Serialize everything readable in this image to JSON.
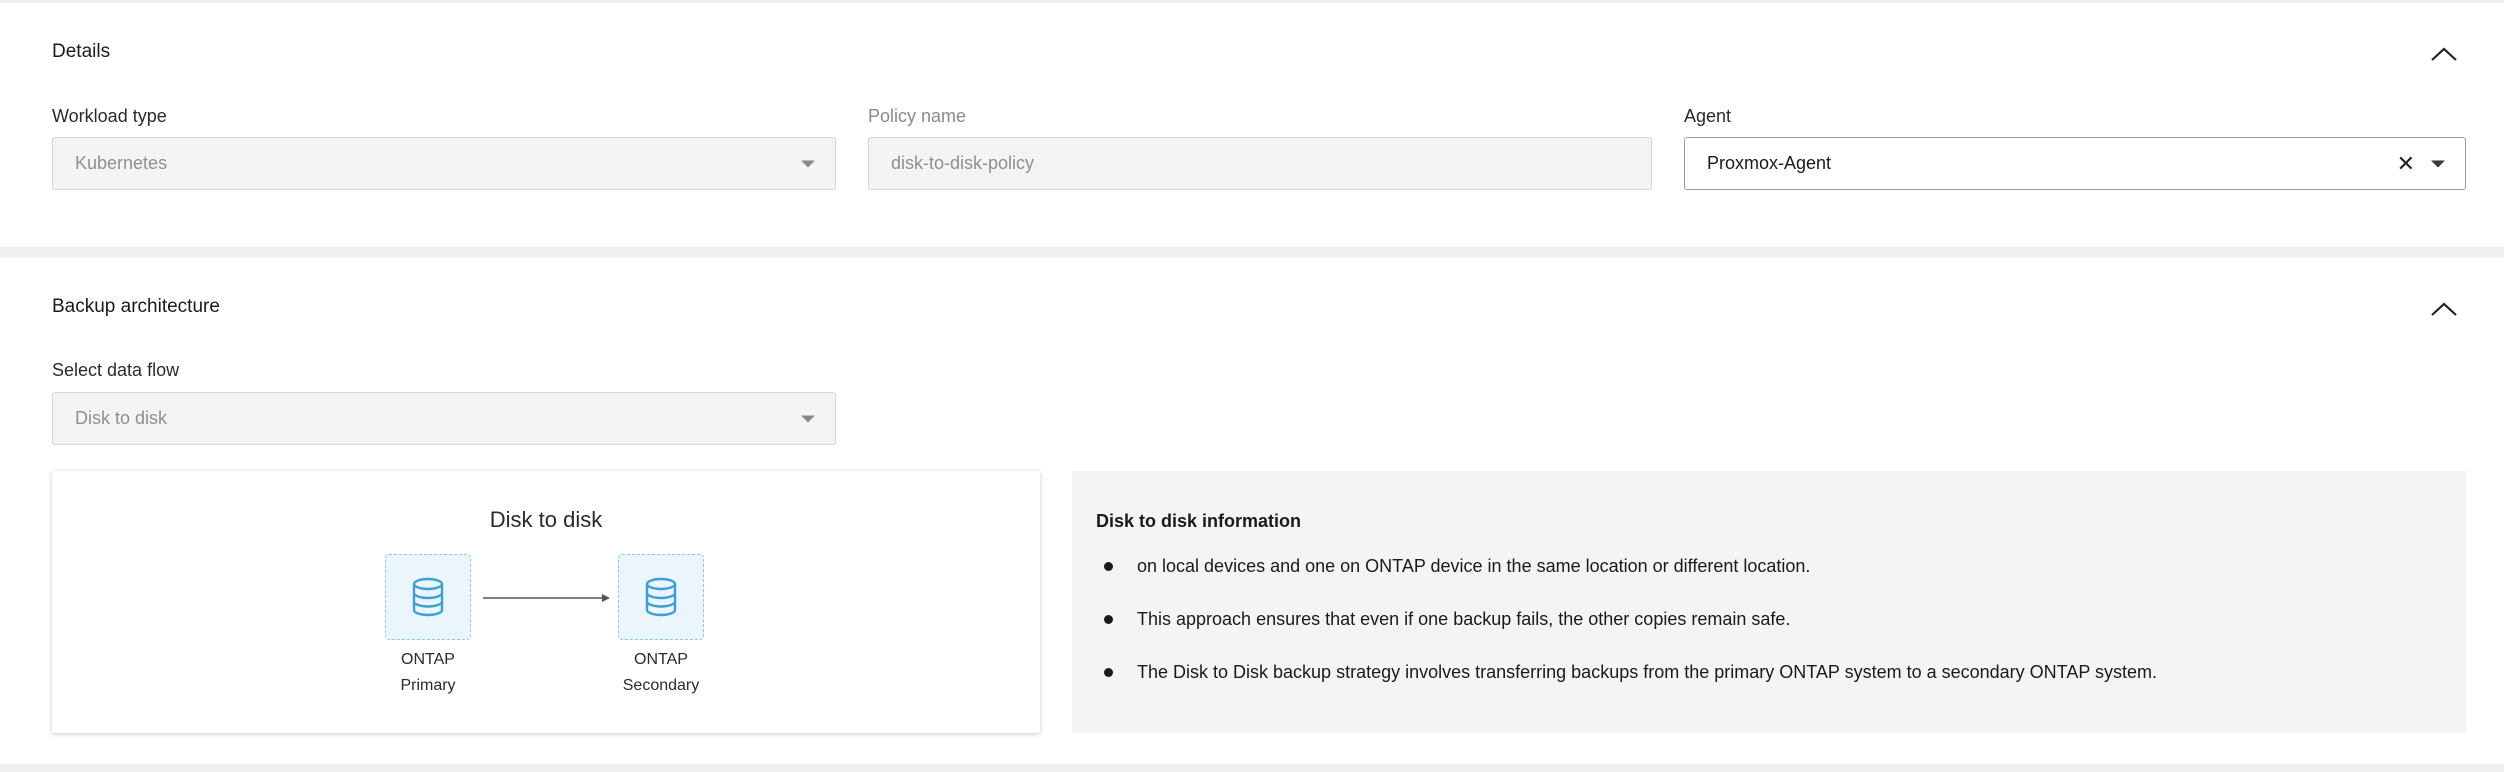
{
  "details": {
    "title": "Details",
    "workload_type": {
      "label": "Workload type",
      "value": "Kubernetes"
    },
    "policy_name": {
      "label": "Policy name",
      "value": "disk-to-disk-policy"
    },
    "agent": {
      "label": "Agent",
      "value": "Proxmox-Agent"
    }
  },
  "backup_architecture": {
    "title": "Backup architecture",
    "data_flow": {
      "label": "Select data flow",
      "value": "Disk to disk"
    },
    "diagram": {
      "title": "Disk to disk",
      "source": {
        "line1": "ONTAP",
        "line2": "Primary"
      },
      "target": {
        "line1": "ONTAP",
        "line2": "Secondary"
      }
    },
    "info": {
      "title": "Disk to disk information",
      "items": [
        "on local devices and one on ONTAP device in the same location or different location.",
        "This approach ensures that even if one backup fails, the other copies remain safe.",
        "The Disk to Disk backup strategy involves transferring backups from the primary ONTAP system to a secondary ONTAP system."
      ]
    }
  },
  "colors": {
    "accent_icon": "#3b9fd8",
    "node_fill": "#eaf5fc",
    "node_border": "#8cc6ea"
  },
  "icons": {
    "collapse": "chevron-up-icon",
    "dropdown": "caret-down-icon",
    "clear": "close-icon",
    "node": "database-icon"
  }
}
